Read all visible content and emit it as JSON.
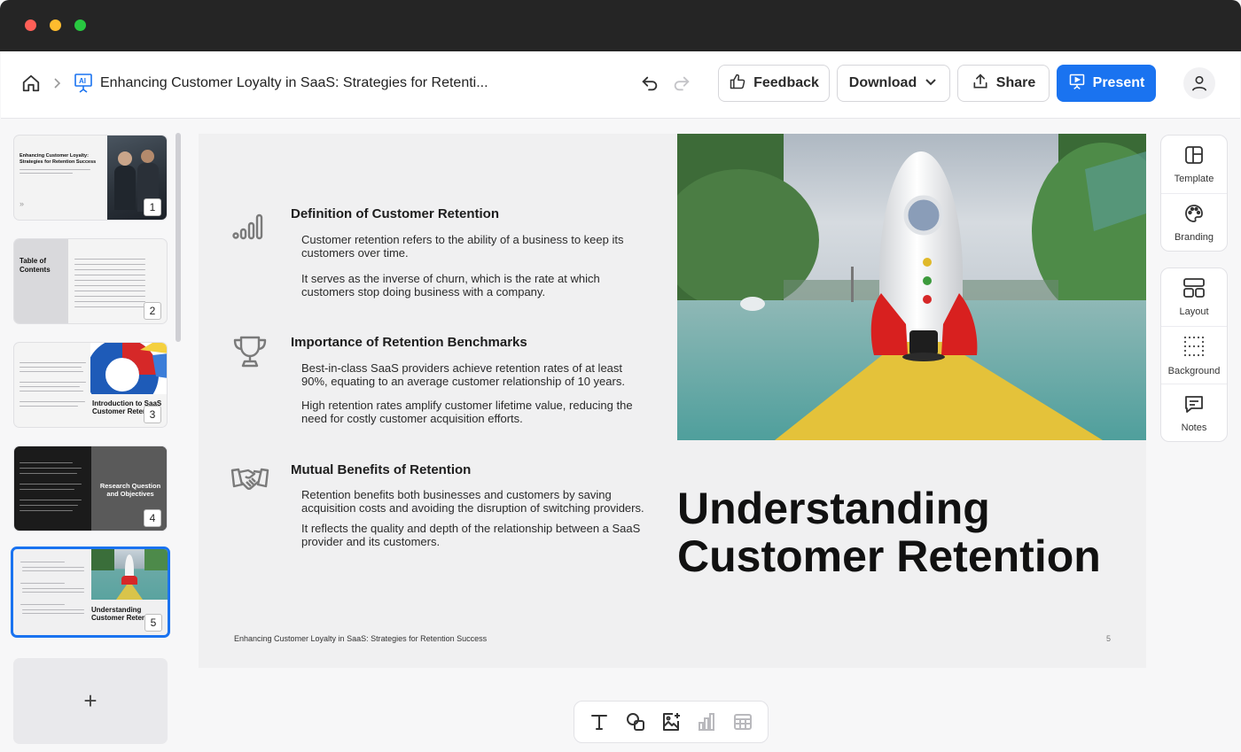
{
  "header": {
    "doc_title": "Enhancing Customer Loyalty in SaaS: Strategies for Retenti...",
    "feedback_label": "Feedback",
    "download_label": "Download",
    "share_label": "Share",
    "present_label": "Present"
  },
  "thumbnails": [
    {
      "number": "1",
      "title": "Enhancing Customer Loyalty: Strategies for Retention Success"
    },
    {
      "number": "2",
      "title": "Table of Contents"
    },
    {
      "number": "3",
      "title": "Introduction to SaaS Customer Retent"
    },
    {
      "number": "4",
      "title": "Research Question and Objectives"
    },
    {
      "number": "5",
      "title": "Understanding Customer Retent"
    }
  ],
  "add_slide_label": "+",
  "slide": {
    "sections": [
      {
        "icon": "signal-bars-icon",
        "heading": "Definition of Customer Retention",
        "paragraphs": [
          "Customer retention refers to the ability of a business to keep its customers over time.",
          "It serves as the inverse of churn, which is the rate at which customers stop doing business with a company."
        ]
      },
      {
        "icon": "trophy-icon",
        "heading": "Importance of Retention Benchmarks",
        "paragraphs": [
          "Best-in-class SaaS providers achieve retention rates of at least 90%, equating to an average customer relationship of 10 years.",
          "High retention rates amplify customer lifetime value, reducing the need for costly customer acquisition efforts."
        ]
      },
      {
        "icon": "handshake-icon",
        "heading": "Mutual Benefits of Retention",
        "paragraphs": [
          "Retention benefits both businesses and customers by saving acquisition costs and avoiding the disruption of switching providers.",
          "It reflects the quality and depth of the relationship between a SaaS provider and its customers."
        ]
      }
    ],
    "title": "Understanding Customer Retention",
    "footer_text": "Enhancing Customer Loyalty in SaaS: Strategies for Retention Success",
    "page_number": "5"
  },
  "right_tools": {
    "group1": [
      "Template",
      "Branding"
    ],
    "group2": [
      "Layout",
      "Background",
      "Notes"
    ]
  },
  "colors": {
    "accent": "#1a73f0",
    "titlebar": "#252525"
  }
}
